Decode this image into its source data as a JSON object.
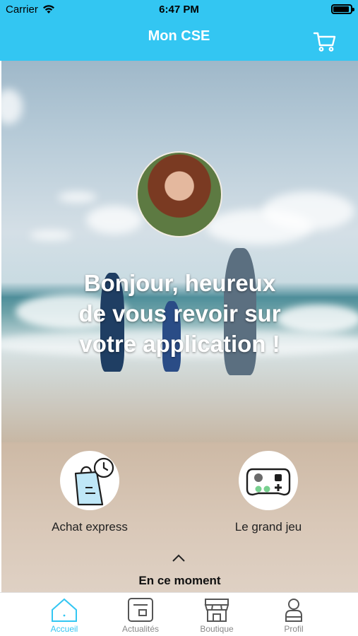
{
  "status_bar": {
    "carrier": "Carrier",
    "time": "6:47 PM"
  },
  "nav": {
    "title": "Mon CSE",
    "cart_icon": "cart-icon"
  },
  "hero": {
    "greeting_lines": [
      "Bonjour, heureux",
      "de vous revoir sur",
      "votre application !"
    ],
    "avatar_icon": "profile-photo"
  },
  "quick_actions": [
    {
      "label": "Achat express",
      "icon": "shopping-bag-clock-icon"
    },
    {
      "label": "Le grand jeu",
      "icon": "game-controller-icon"
    }
  ],
  "section": {
    "title": "En ce moment",
    "chevron_icon": "chevron-up-icon"
  },
  "tabs": [
    {
      "label": "Accueil",
      "icon": "home-icon",
      "active": true
    },
    {
      "label": "Actualités",
      "icon": "news-icon",
      "active": false
    },
    {
      "label": "Boutique",
      "icon": "store-icon",
      "active": false
    },
    {
      "label": "Profil",
      "icon": "user-icon",
      "active": false
    }
  ],
  "colors": {
    "brand": "#33c6f2",
    "inactive_tab": "#888888"
  }
}
